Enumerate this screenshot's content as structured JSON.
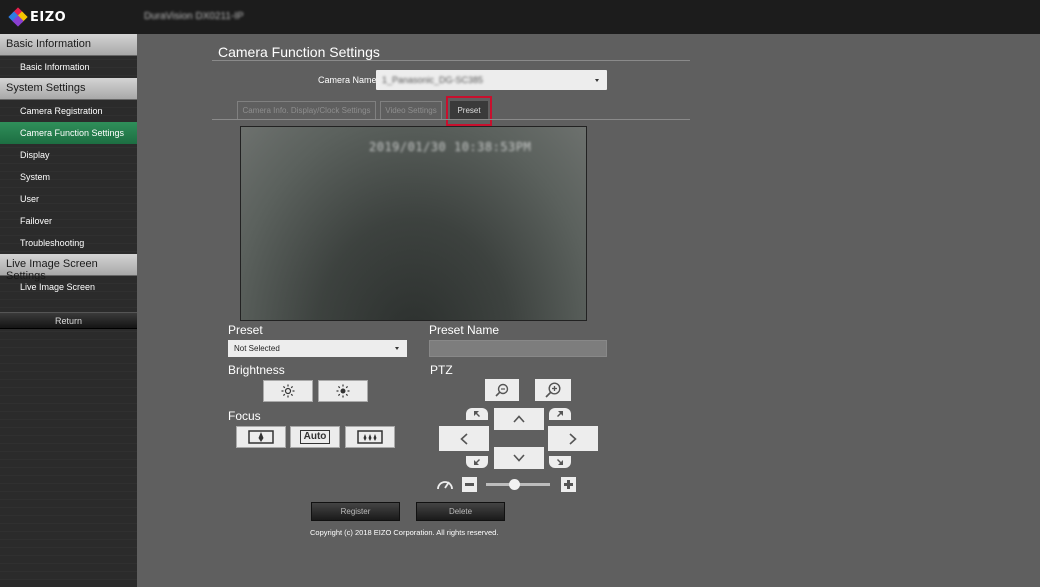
{
  "app": {
    "brand": "EIZO",
    "model_name": "DuraVision DX0211-IP"
  },
  "sidebar": {
    "sections": [
      {
        "header": "Basic Information",
        "items": [
          {
            "label": "Basic Information",
            "active": false
          }
        ]
      },
      {
        "header": "System Settings",
        "items": [
          {
            "label": "Camera Registration",
            "active": false
          },
          {
            "label": "Camera Function Settings",
            "active": true
          },
          {
            "label": "Display",
            "active": false
          },
          {
            "label": "System",
            "active": false
          },
          {
            "label": "User",
            "active": false
          },
          {
            "label": "Failover",
            "active": false
          },
          {
            "label": "Troubleshooting",
            "active": false
          }
        ]
      },
      {
        "header": "Live Image Screen Settings",
        "items": [
          {
            "label": "Live Image Screen",
            "active": false
          }
        ]
      }
    ],
    "return_label": "Return"
  },
  "main": {
    "title": "Camera Function Settings",
    "camera_name_label": "Camera Name",
    "camera_name_value": "1_Panasonic_DG-SC385",
    "tabs": [
      {
        "label": "Camera Info. Display/Clock Settings",
        "active": false
      },
      {
        "label": "Video Settings",
        "active": false
      },
      {
        "label": "Preset",
        "active": true
      }
    ],
    "video_timestamp": "2019/01/30 10:38:53PM",
    "preset": {
      "label": "Preset",
      "selected": "Not Selected"
    },
    "preset_name": {
      "label": "Preset Name",
      "value": ""
    },
    "brightness": {
      "label": "Brightness"
    },
    "focus": {
      "label": "Focus",
      "auto_label": "Auto"
    },
    "ptz": {
      "label": "PTZ"
    },
    "register_label": "Register",
    "delete_label": "Delete",
    "copyright": "Copyright (c) 2018 EIZO Corporation. All rights reserved."
  },
  "colors": {
    "active_nav": "#2a8a55",
    "highlight": "#c8102e",
    "background": "#5f5f5f",
    "topbar": "#1c1c1c"
  }
}
